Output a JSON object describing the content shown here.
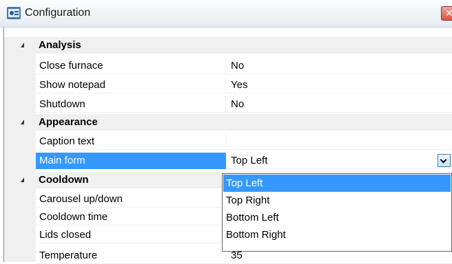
{
  "window": {
    "title": "Configuration",
    "close_glyph": "✕",
    "icon": "app-config-icon"
  },
  "categories": [
    {
      "label": "Analysis",
      "rows": [
        {
          "name": "Close furnace",
          "value": "No"
        },
        {
          "name": "Show notepad",
          "value": "Yes"
        },
        {
          "name": "Shutdown",
          "value": "No"
        }
      ]
    },
    {
      "label": "Appearance",
      "rows": [
        {
          "name": "Caption text",
          "value": ""
        },
        {
          "name": "Main form",
          "value": "Top Left"
        }
      ]
    },
    {
      "label": "Cooldown",
      "rows": [
        {
          "name": "Carousel up/down",
          "value": ""
        },
        {
          "name": "Cooldown time",
          "value": ""
        },
        {
          "name": "Lids closed",
          "value": ""
        },
        {
          "name": "Temperature",
          "value": "35"
        }
      ]
    }
  ],
  "dropdown": {
    "options": [
      "Top Left",
      "Top Right",
      "Bottom Left",
      "Bottom Right"
    ],
    "selected": "Top Left"
  },
  "colors": {
    "selection": "#3399ff",
    "category_bg": "#f0f0f0"
  }
}
